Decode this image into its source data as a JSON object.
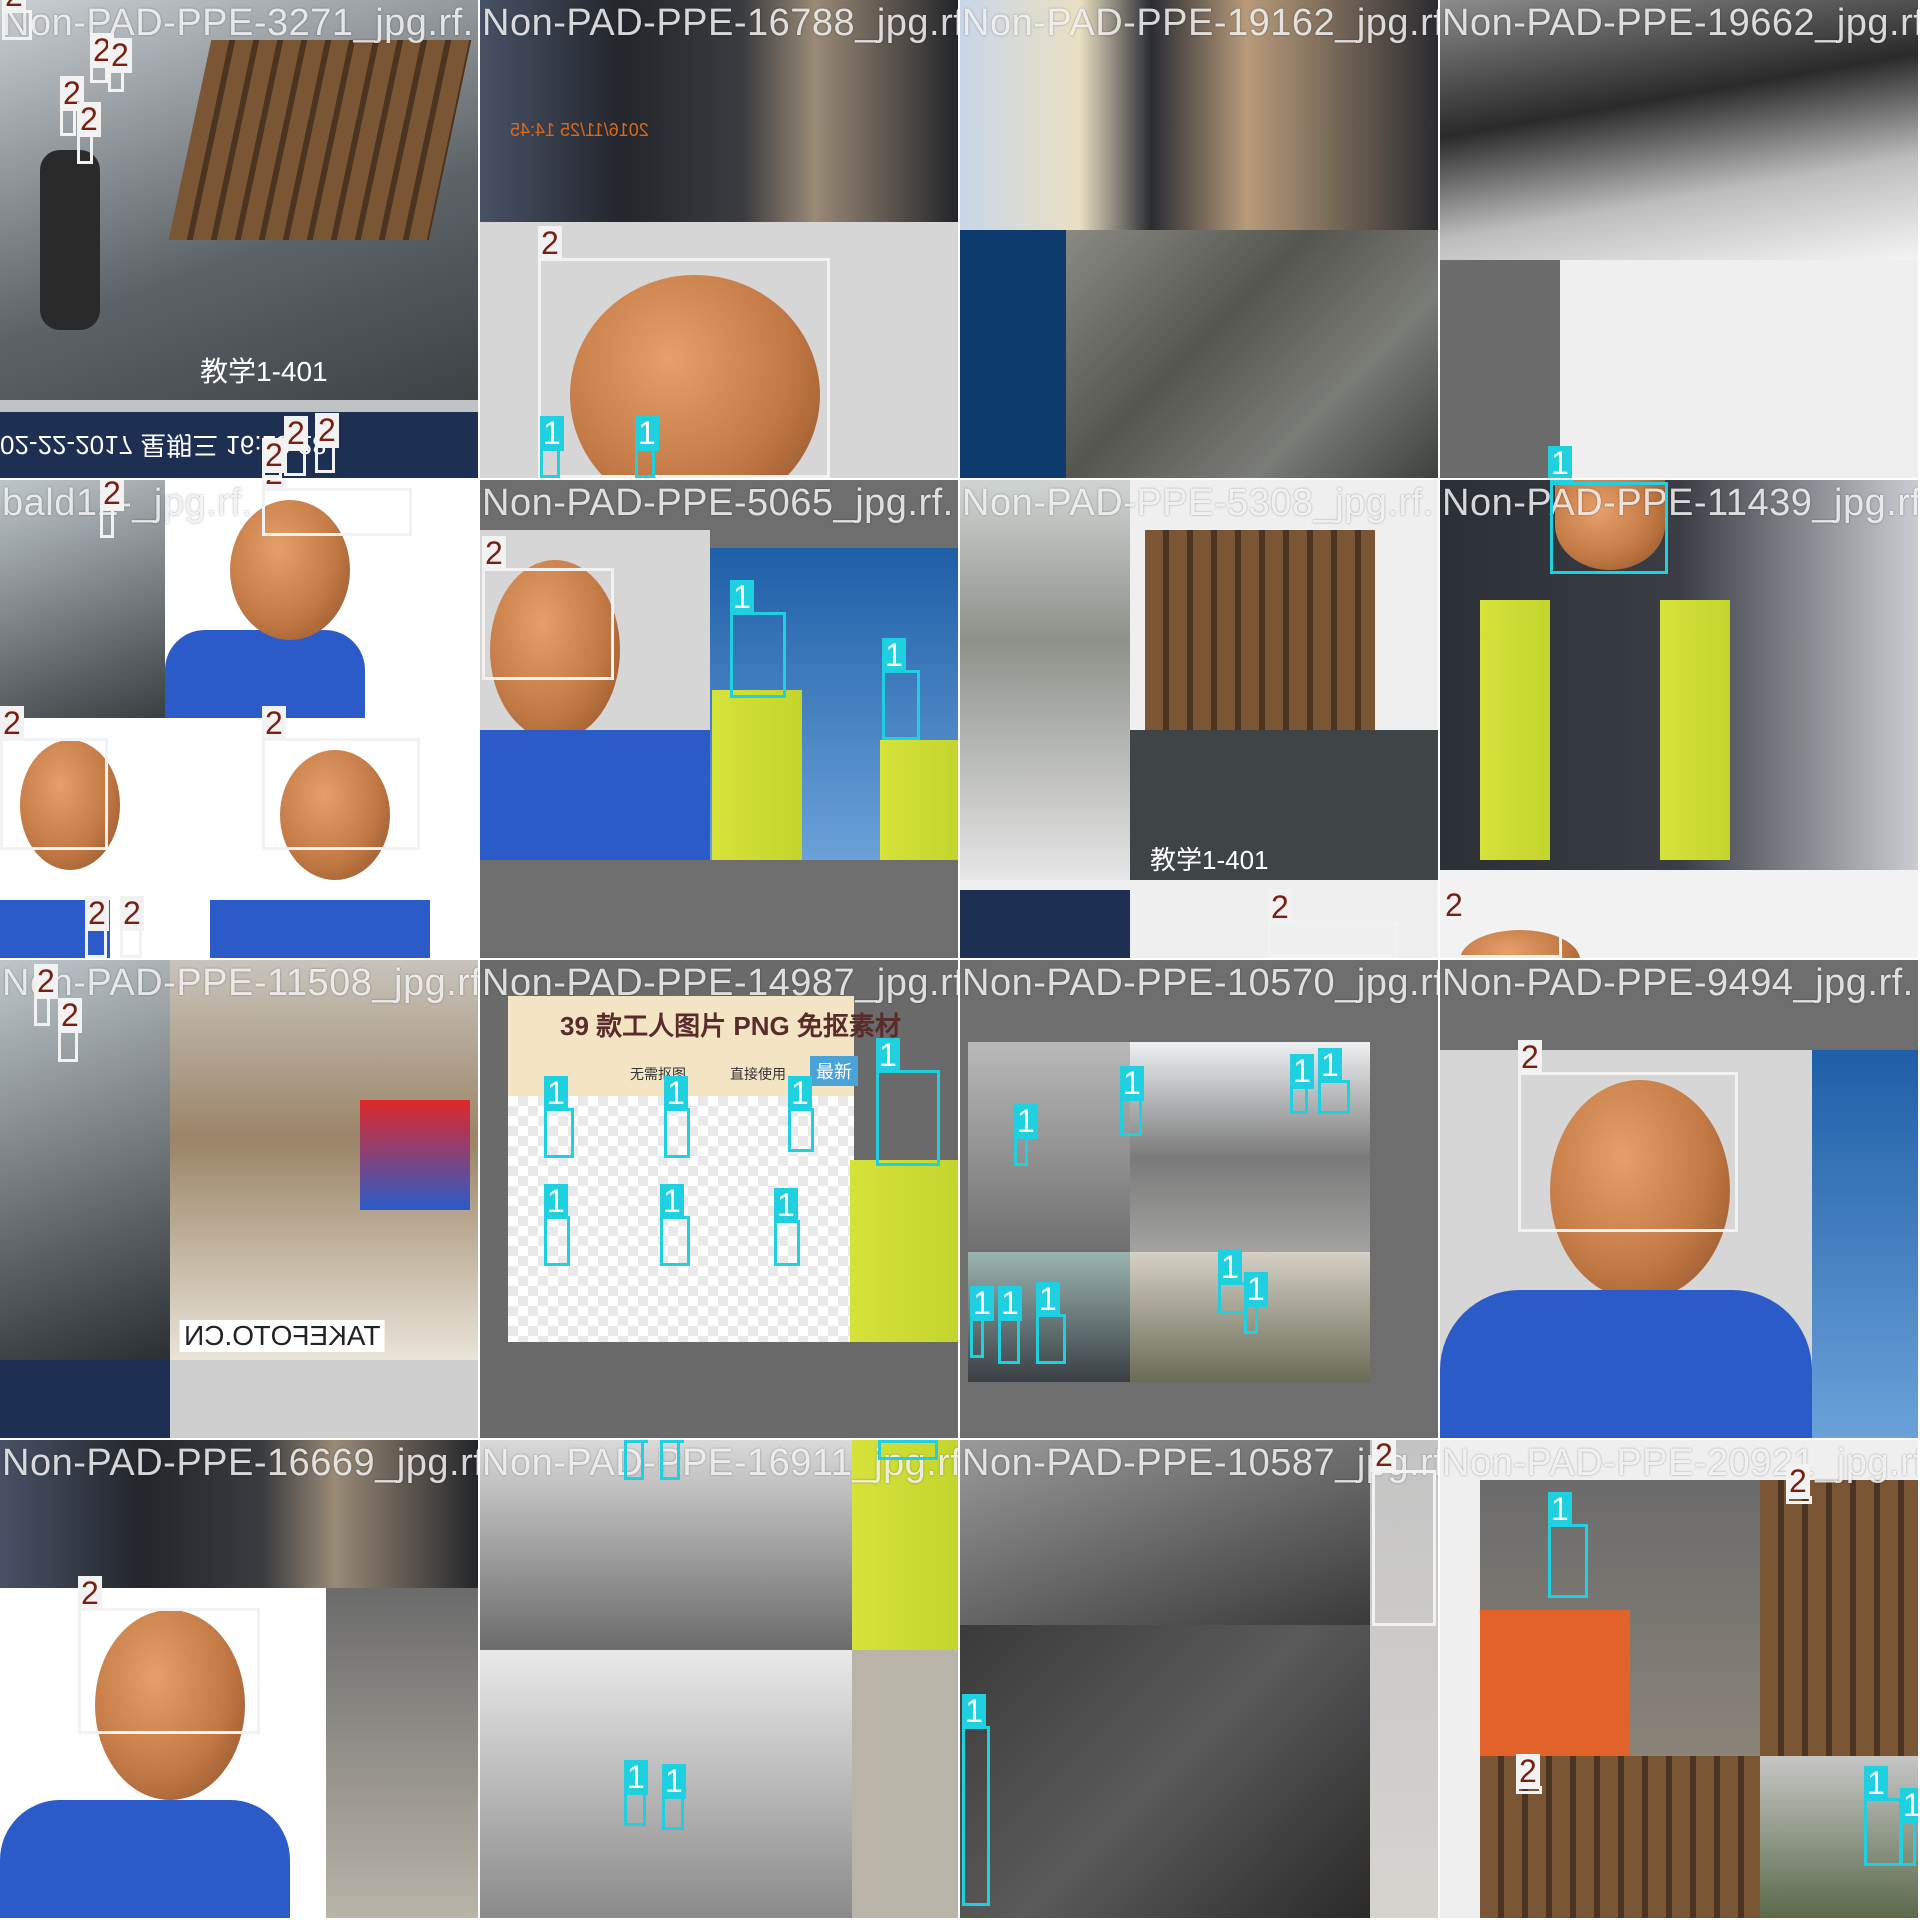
{
  "image": {
    "type": "object-detection-training-batch-mosaic",
    "grid": "4x4",
    "class_colors": {
      "1": "#1fd0e0",
      "2": "#f2f2f2"
    },
    "label_text_colors": {
      "1": "#ffffff",
      "2": "#7a1f10"
    }
  },
  "tiles": [
    {
      "filename": "Non-PAD-PPE-3271_jpg.rf.",
      "classes": [
        "2",
        "2",
        "2",
        "2",
        "2",
        "2",
        "2",
        "2"
      ]
    },
    {
      "filename": "Non-PAD-PPE-16788_jpg.rf.",
      "classes": [
        "2",
        "1",
        "1"
      ]
    },
    {
      "filename": "Non-PAD-PPE-19162_jpg.rf.",
      "classes": []
    },
    {
      "filename": "Non-PAD-PPE-19662_jpg.rf.",
      "classes": [
        "1"
      ]
    },
    {
      "filename": "bald12-_jpg.rf.",
      "classes": [
        "2",
        "2",
        "2",
        "2",
        "2",
        "2"
      ]
    },
    {
      "filename": "Non-PAD-PPE-5065_jpg.rf.",
      "classes": [
        "2",
        "1",
        "1"
      ]
    },
    {
      "filename": "Non-PAD-PPE-5308_jpg.rf.",
      "classes": [
        "2"
      ]
    },
    {
      "filename": "Non-PAD-PPE-11439_jpg.rf.",
      "classes": [
        "1",
        "2"
      ]
    },
    {
      "filename": "Non-PAD-PPE-11508_jpg.rf.",
      "classes": [
        "2",
        "2"
      ]
    },
    {
      "filename": "Non-PAD-PPE-14987_jpg.rf.",
      "classes": [
        "1",
        "1",
        "1",
        "1",
        "1",
        "1",
        "1"
      ]
    },
    {
      "filename": "Non-PAD-PPE-10570_jpg.rf.",
      "classes": [
        "1",
        "1",
        "1",
        "1",
        "1",
        "1",
        "1",
        "1",
        "1"
      ]
    },
    {
      "filename": "Non-PAD-PPE-9494_jpg.rf.",
      "classes": [
        "2"
      ]
    },
    {
      "filename": "Non-PAD-PPE-16669_jpg.rf.",
      "classes": [
        "2"
      ]
    },
    {
      "filename": "Non-PAD-PPE-16911_jpg.rf.",
      "classes": [
        "1",
        "1",
        "1",
        "1",
        "1"
      ]
    },
    {
      "filename": "Non-PAD-PPE-10587_jpg.rf.",
      "classes": [
        "2",
        "1"
      ]
    },
    {
      "filename": "Non-PAD-PPE-20921_jpg.rf.",
      "classes": [
        "1",
        "2",
        "2",
        "1",
        "1"
      ]
    }
  ],
  "embedded_text": {
    "poster_title": "39 款工人图片 PNG 免抠素材",
    "poster_sub1": "无需抠图",
    "poster_sub2": "直接使用",
    "poster_badge": "最新",
    "cctv_caption": "教学1-401",
    "cctv_date": "02-22-2017 星期三 16:13:28",
    "watermark": "TAKEFOTO.CN",
    "photo_date": "2016/11/25 14:45"
  },
  "labels": {
    "one": "1",
    "two": "2"
  }
}
